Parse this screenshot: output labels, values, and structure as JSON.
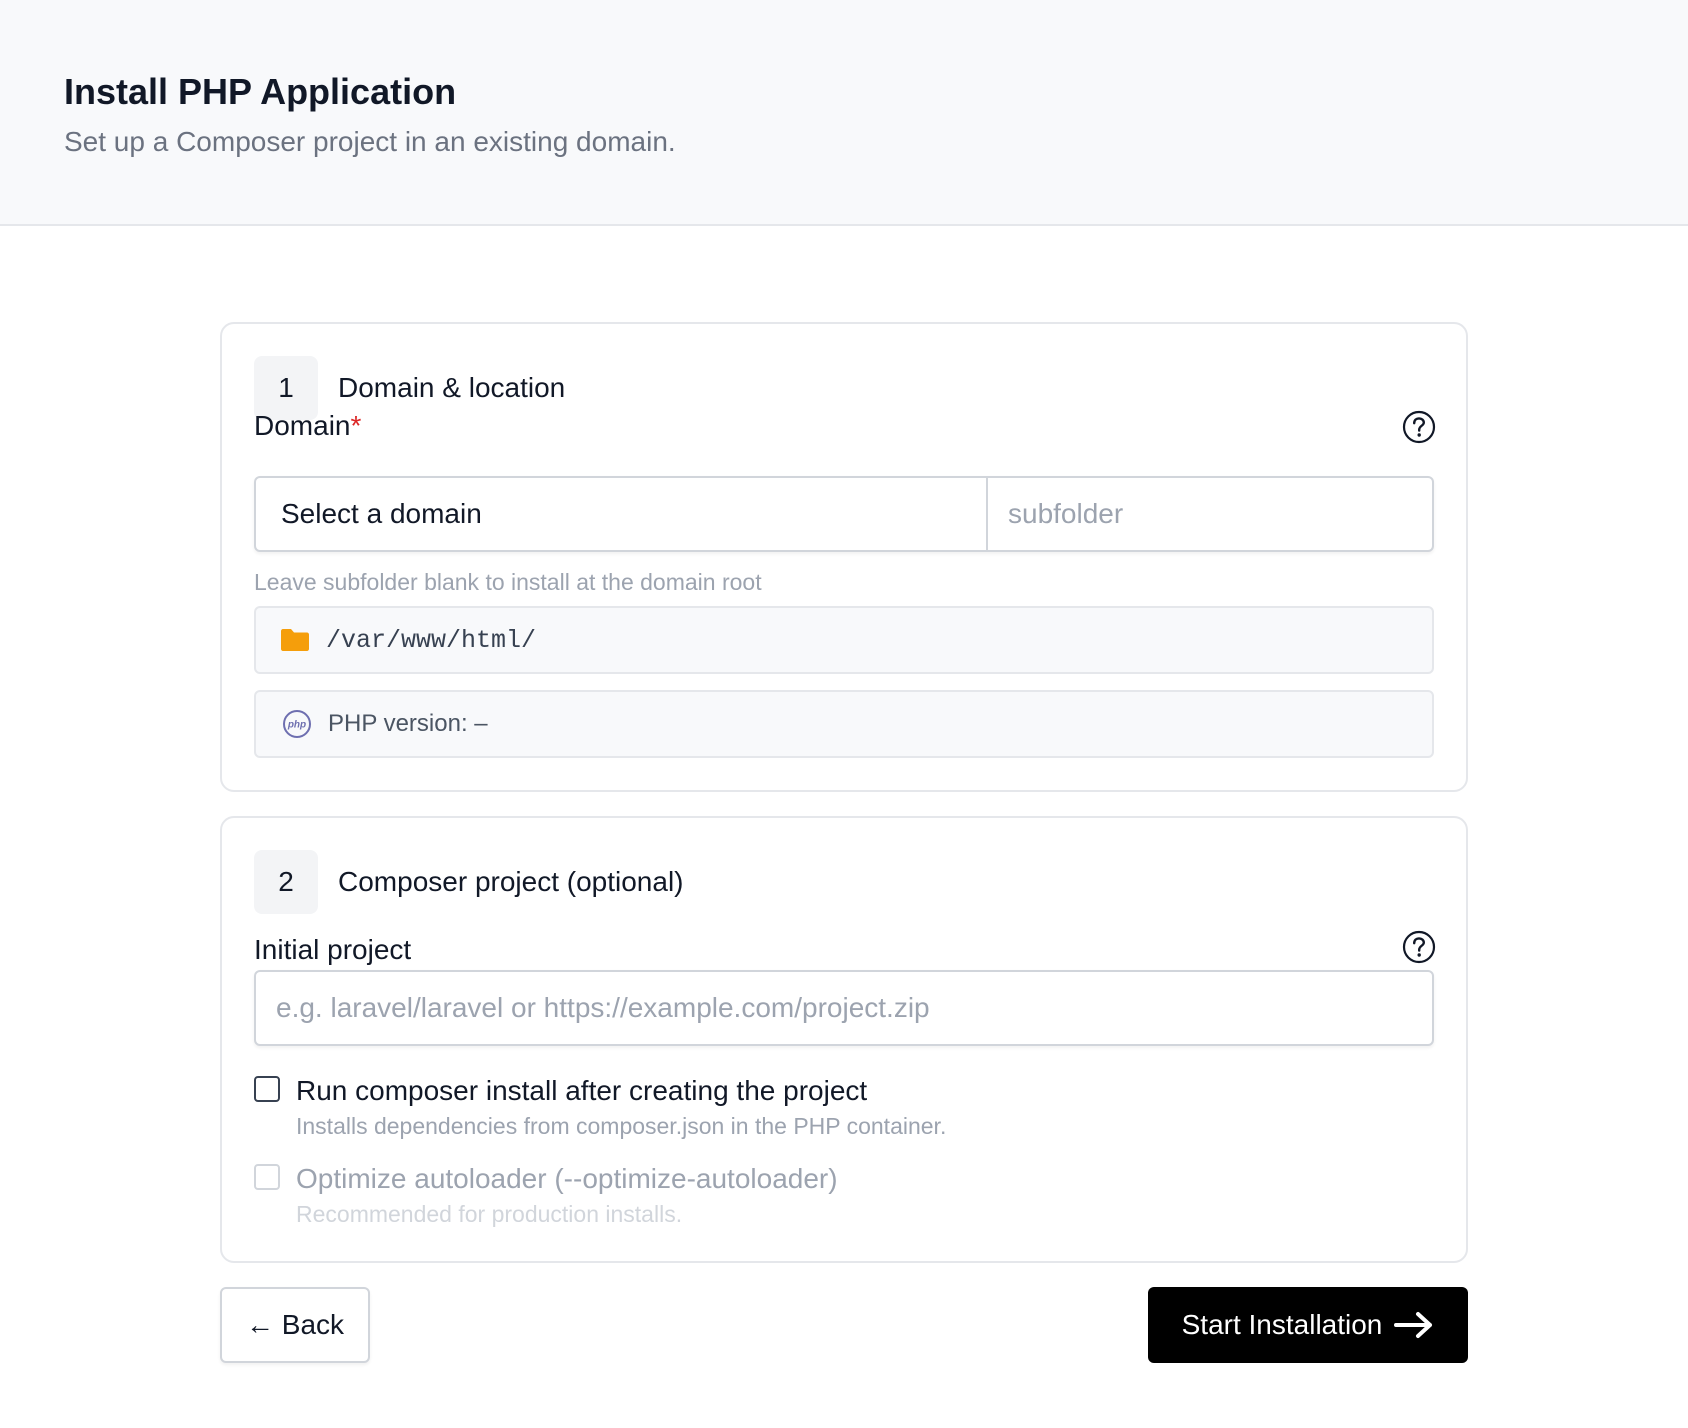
{
  "header": {
    "title": "Install PHP Application",
    "subtitle": "Set up a Composer project in an existing domain."
  },
  "step1": {
    "number": "1",
    "title": "Domain & location",
    "domain_label": "Domain",
    "required_marker": "*",
    "domain_select_value": "Select a domain",
    "subfolder_placeholder": "subfolder",
    "hint": "Leave subfolder blank to install at the domain root",
    "path": "/var/www/html/",
    "php_version_text": "PHP version: –",
    "help_icon": "question-circle-icon",
    "folder_icon": "folder-icon",
    "php_icon": "php-icon"
  },
  "step2": {
    "number": "2",
    "title": "Composer project (optional)",
    "project_label": "Initial project",
    "project_placeholder": "e.g. laravel/laravel or https://example.com/project.zip",
    "help_icon": "question-circle-icon",
    "run_install": {
      "label": "Run composer install after creating the project",
      "description": "Installs dependencies from composer.json in the PHP container.",
      "checked": false
    },
    "optimize": {
      "label": "Optimize autoloader (--optimize-autoloader)",
      "description": "Recommended for production installs.",
      "checked": false,
      "disabled": true
    }
  },
  "footer": {
    "back_label": "← Back",
    "start_label": "Start Installation",
    "start_icon": "arrow-right-icon"
  },
  "colors": {
    "accent": "#000000",
    "required": "#dc2626",
    "folder": "#f59e0b",
    "php": "#6e6fb0"
  }
}
